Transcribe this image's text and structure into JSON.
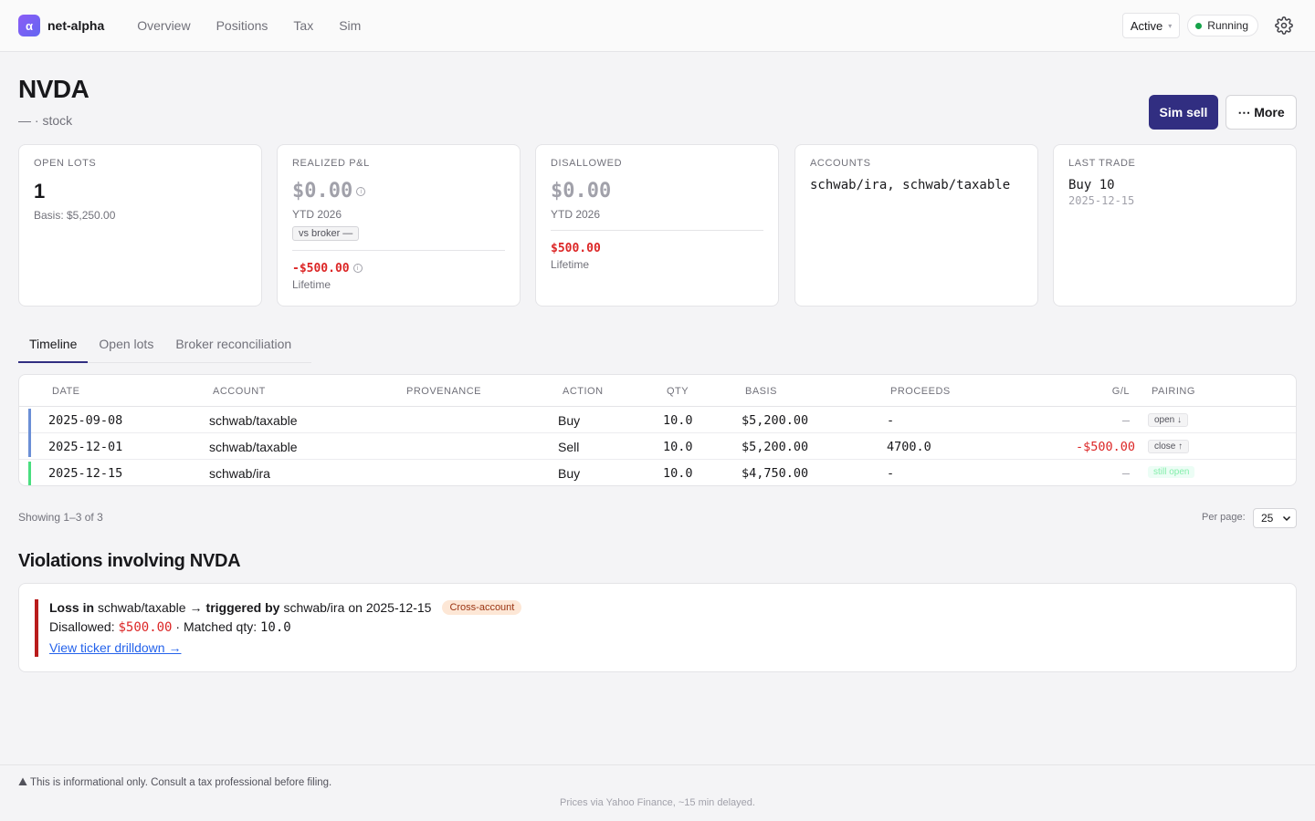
{
  "app": {
    "logo_glyph": "α",
    "name": "net-alpha"
  },
  "nav": {
    "items": [
      "Overview",
      "Positions",
      "Tax",
      "Sim"
    ]
  },
  "topbar": {
    "account_filter": "Active",
    "status": "Running",
    "status_color": "#16a34a"
  },
  "header": {
    "ticker": "NVDA",
    "subtitle": "— · stock",
    "sim_sell_label": "Sim sell",
    "more_label": "⋯ More"
  },
  "cards": {
    "open_lots": {
      "label": "Open lots",
      "value": "1",
      "basis": "Basis: $5,250.00"
    },
    "realized": {
      "label": "Realized P&L",
      "value": "$0.00",
      "period": "YTD 2026",
      "broker_chip": "vs broker —",
      "lifetime_value": "-$500.00",
      "lifetime_label": "Lifetime"
    },
    "disallowed": {
      "label": "Disallowed",
      "value": "$0.00",
      "period": "YTD 2026",
      "lifetime_value": "$500.00",
      "lifetime_label": "Lifetime"
    },
    "accounts": {
      "label": "Accounts",
      "value": "schwab/ira, schwab/taxable"
    },
    "last_trade": {
      "label": "Last trade",
      "value": "Buy 10",
      "date": "2025-12-15"
    }
  },
  "tabs": [
    "Timeline",
    "Open lots",
    "Broker reconciliation"
  ],
  "table": {
    "columns": [
      "Date",
      "Account",
      "Provenance",
      "Action",
      "Qty",
      "Basis",
      "Proceeds",
      "G/L",
      "Pairing"
    ],
    "rows": [
      {
        "date": "2025-09-08",
        "account": "schwab/taxable",
        "provenance": "",
        "action": "Buy",
        "qty": "10.0",
        "basis": "$5,200.00",
        "proceeds": "-",
        "gl": "—",
        "pairing": "open ↓"
      },
      {
        "date": "2025-12-01",
        "account": "schwab/taxable",
        "provenance": "",
        "action": "Sell",
        "qty": "10.0",
        "basis": "$5,200.00",
        "proceeds": "4700.0",
        "gl": "-$500.00",
        "pairing": "close ↑"
      },
      {
        "date": "2025-12-15",
        "account": "schwab/ira",
        "provenance": "",
        "action": "Buy",
        "qty": "10.0",
        "basis": "$4,750.00",
        "proceeds": "-",
        "gl": "—",
        "pairing": "still open"
      }
    ]
  },
  "pagination": {
    "showing": "Showing 1–3 of 3",
    "per_page_label": "Per page:",
    "per_page_value": "25"
  },
  "violations": {
    "title": "Violations involving NVDA",
    "items": [
      {
        "loss_in_label": "Loss in",
        "loss_account": "schwab/taxable",
        "arrow": "→",
        "triggered_label": "triggered by",
        "trigger_account": "schwab/ira",
        "on_text": "on 2025-12-15",
        "badge": "Cross-account",
        "disallowed_label": "Disallowed:",
        "disallowed_value": "$500.00",
        "matched_label": "· Matched qty:",
        "matched_value": "10.0",
        "link": "View ticker drilldown →"
      }
    ]
  },
  "footer": {
    "disclaimer": "This is informational only. Consult a tax professional before filing.",
    "prices": "Prices via Yahoo Finance, ~15 min delayed."
  }
}
